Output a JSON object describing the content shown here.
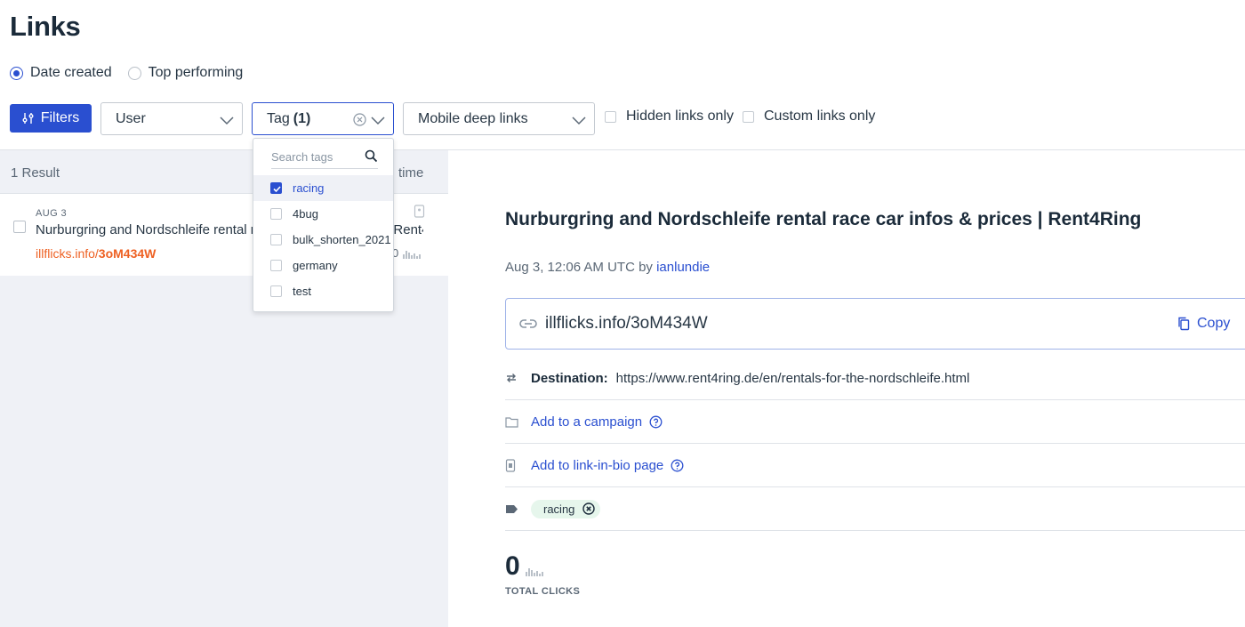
{
  "page": {
    "title": "Links"
  },
  "sort": {
    "options": [
      {
        "label": "Date created",
        "selected": true
      },
      {
        "label": "Top performing",
        "selected": false
      }
    ]
  },
  "filter_bar": {
    "filters_label": "Filters",
    "user_select": "User",
    "tag_select": {
      "label": "Tag",
      "count": "(1)"
    },
    "mobile_select": "Mobile deep links",
    "hidden_only": "Hidden links only",
    "custom_only": "Custom links only"
  },
  "tag_dropdown": {
    "search_placeholder": "Search tags",
    "items": [
      {
        "label": "racing",
        "checked": true
      },
      {
        "label": "4bug",
        "checked": false
      },
      {
        "label": "bulk_shorten_2021",
        "checked": false
      },
      {
        "label": "germany",
        "checked": false
      },
      {
        "label": "test",
        "checked": false
      }
    ]
  },
  "results": {
    "count": "1 Result",
    "sort_label": "time",
    "rows": [
      {
        "date": "AUG 3",
        "title": "Nurburgring and Nordschleife rental race car infos & prices | Rent4Ring",
        "url_domain": "illflicks.info/",
        "url_slug": "3oM434W",
        "clicks": "0"
      }
    ]
  },
  "detail": {
    "title": "Nurburgring and Nordschleife rental race car infos & prices | Rent4Ring",
    "meta_date": "Aug 3, 12:06 AM UTC by ",
    "meta_user": "ianlundie",
    "short_link": "illflicks.info/3oM434W",
    "copy_label": "Copy",
    "destination_label": "Destination:",
    "destination_url": "https://www.rent4ring.de/en/rentals-for-the-nordschleife.html",
    "campaign_link": "Add to a campaign",
    "bio_link": "Add to link-in-bio page",
    "tag": "racing",
    "total_clicks": "0",
    "total_clicks_label": "TOTAL CLICKS"
  },
  "colors": {
    "accent": "#2a4fd0",
    "link_orange": "#ee6123",
    "pane_bg": "#eff1f6",
    "tag_bg": "#e6f6ec"
  }
}
